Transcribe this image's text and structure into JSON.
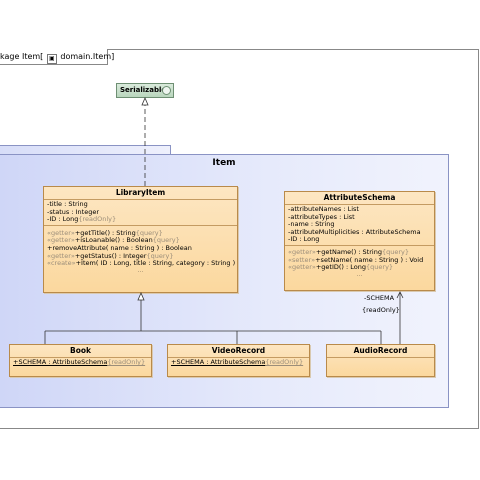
{
  "package_tab": {
    "prefix": "kage",
    "name": "Item",
    "bracket_open": "[",
    "ref": "domain.Item",
    "bracket_close": "]"
  },
  "interface": {
    "name": "Serializable"
  },
  "package": {
    "name": "Item"
  },
  "library_item": {
    "name": "LibraryItem",
    "attributes": [
      "-title : String",
      "-status : Integer"
    ],
    "id_attr": "-ID : Long",
    "id_mod": "{readOnly}",
    "ops": [
      {
        "stereo": "«getter»",
        "sig": "+getTitle() : String",
        "mod": "{query}"
      },
      {
        "stereo": "«getter»",
        "sig": "+isLoanable() : Boolean",
        "mod": "{query}"
      },
      {
        "stereo": "",
        "sig": "+removeAttribute( name : String ) : Boolean",
        "mod": ""
      },
      {
        "stereo": "«getter»",
        "sig": "+getStatus() : Integer",
        "mod": "{query}"
      },
      {
        "stereo": "«create»",
        "sig": "+Item( ID : Long, title : String, category : String ) : Void",
        "mod": ""
      }
    ],
    "dots": "..."
  },
  "attribute_schema": {
    "name": "AttributeSchema",
    "attributes": [
      "-attributeNames : List",
      "-attributeTypes : List",
      "-name : String",
      "-attributeMultiplicities : AttributeSchema",
      "-ID : Long"
    ],
    "ops": [
      {
        "stereo": "«getter»",
        "sig": "+getName() : String",
        "mod": "{query}"
      },
      {
        "stereo": "«setter»",
        "sig": "+setName( name : String ) : Void",
        "mod": ""
      },
      {
        "stereo": "«getter»",
        "sig": "+getID() : Long",
        "mod": "{query}"
      }
    ],
    "dots": "..."
  },
  "book": {
    "name": "Book",
    "attr": "+SCHEMA : AttributeSchema",
    "mod": "{readOnly}"
  },
  "video_record": {
    "name": "VideoRecord",
    "attr": "+SCHEMA : AttributeSchema",
    "mod": "{readOnly}"
  },
  "audio_record": {
    "name": "AudioRecord"
  },
  "association": {
    "role": "-SCHEMA",
    "mod": "{readOnly}"
  }
}
